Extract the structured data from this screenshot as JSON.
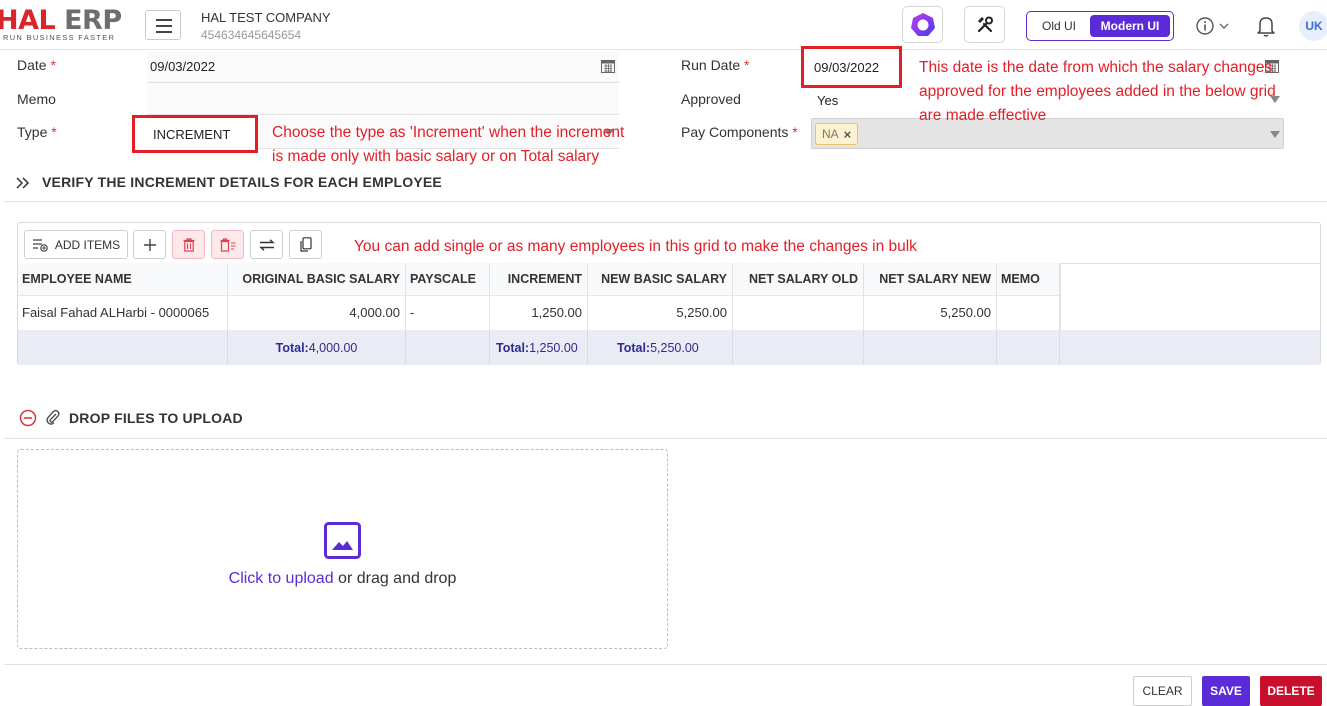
{
  "app": {
    "logo_hal": "HAL",
    "logo_erp": " ERP",
    "logo_tagline": "RUN BUSINESS FASTER",
    "company_name": "HAL TEST COMPANY",
    "company_id": "454634645645654",
    "ui_toggle": {
      "old": "Old UI",
      "modern": "Modern UI",
      "selected": "Modern UI"
    },
    "avatar_text": "UK",
    "brand_color": "#5b2bd8",
    "accent_red": "#e41e26"
  },
  "form": {
    "date_label": "Date",
    "date_value": "09/03/2022",
    "memo_label": "Memo",
    "memo_value": "",
    "type_label": "Type",
    "type_value": "INCREMENT",
    "run_date_label": "Run Date",
    "run_date_value": "09/03/2022",
    "approved_label": "Approved",
    "approved_value": "Yes",
    "pay_components_label": "Pay Components",
    "pay_components_tag": "NA",
    "required_mark": "*"
  },
  "annotations": {
    "type_note_1": "Choose the type as 'Increment' when the increment",
    "type_note_2": "is made only with basic salary or on Total salary",
    "run_date_note_1": "This date is the date from which the salary changes",
    "run_date_note_2": "approved for the employees added in the below grid",
    "run_date_note_3": "are made effective",
    "grid_note": "You can add single or as many employees in this grid to make the changes in bulk"
  },
  "section": {
    "verify_title": "VERIFY THE INCREMENT DETAILS FOR EACH EMPLOYEE",
    "upload_title": "DROP FILES TO UPLOAD"
  },
  "grid": {
    "add_items_label": "ADD ITEMS",
    "columns": [
      "EMPLOYEE NAME",
      "ORIGINAL BASIC SALARY",
      "PAYSCALE",
      "INCREMENT",
      "NEW BASIC SALARY",
      "NET SALARY OLD",
      "NET SALARY NEW",
      "MEMO"
    ],
    "rows": [
      [
        "Faisal Fahad ALHarbi - 0000065",
        "4,000.00",
        "-",
        "1,250.00",
        "5,250.00",
        "",
        "5,250.00",
        ""
      ]
    ],
    "totals": {
      "label": "Total:",
      "original_basic_salary": "4,000.00",
      "increment": "1,250.00",
      "new_basic_salary": "5,250.00"
    }
  },
  "upload": {
    "link_text": "Click to upload",
    "rest_text": " or drag and drop"
  },
  "footer": {
    "clear": "CLEAR",
    "save": "SAVE",
    "delete": "DELETE"
  }
}
